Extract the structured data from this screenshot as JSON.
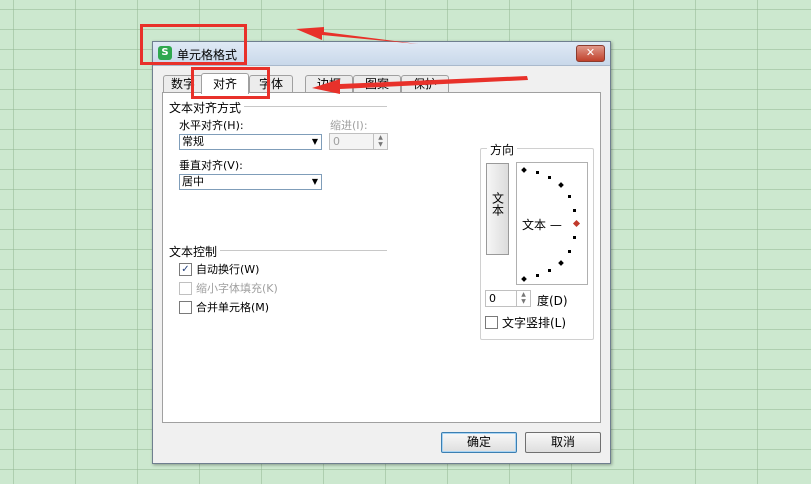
{
  "dialog": {
    "title": "单元格格式",
    "app_icon": "S",
    "close_glyph": "✕"
  },
  "tabs": [
    {
      "label": "数字"
    },
    {
      "label": "对齐"
    },
    {
      "label": "字体"
    },
    {
      "label": "边框"
    },
    {
      "label": "图案"
    },
    {
      "label": "保护"
    }
  ],
  "alignment": {
    "group_title": "文本对齐方式",
    "horizontal_label": "水平对齐(H):",
    "horizontal_value": "常规",
    "indent_label": "缩进(I):",
    "indent_value": "0",
    "vertical_label": "垂直对齐(V):",
    "vertical_value": "居中"
  },
  "text_control": {
    "group_title": "文本控制",
    "wrap_text": {
      "label": "自动换行(W)",
      "checked": true
    },
    "shrink_to_fit": {
      "label": "缩小字体填充(K)",
      "checked": false
    },
    "merge_cells": {
      "label": "合并单元格(M)",
      "checked": false
    }
  },
  "orientation": {
    "group_title": "方向",
    "vertical_text": "文本",
    "dial_text": "文本 —",
    "degree_value": "0",
    "degree_label": "度(D)",
    "stacked_text": {
      "label": "文字竖排(L)",
      "checked": false
    }
  },
  "buttons": {
    "ok": "确定",
    "cancel": "取消"
  },
  "colors": {
    "annotation": "#e8312a",
    "sheet_bg": "#cce8cf",
    "dial_pointer": "#c0392b"
  }
}
